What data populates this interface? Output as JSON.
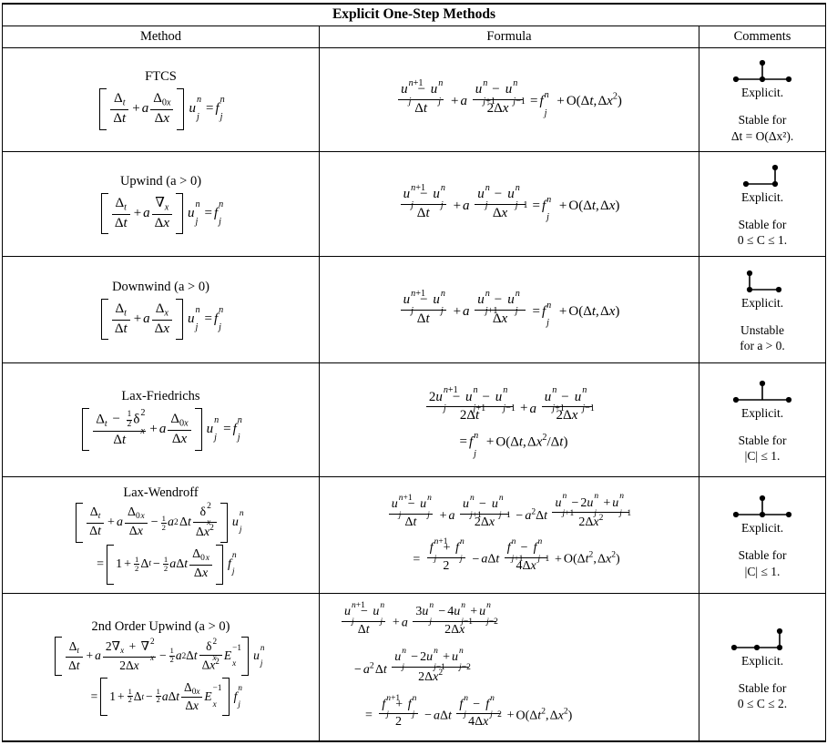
{
  "table": {
    "title": "Explicit One-Step Methods",
    "columns": [
      "Method",
      "Formula",
      "Comments"
    ],
    "rows": [
      {
        "method_name": "FTCS",
        "method_equation": "[ Delta_t/Delta t + a Delta_0x/Delta x ] u_j^n = f_j^n",
        "formula": "(u_j^{n+1} - u_j^n)/Delta t + a (u_{j+1}^n - u_{j-1}^n)/(2 Delta x) = f_j^n + O(Delta t, Delta x^2)",
        "stencil": "T-shape: three nodes at level n (j-1, j, j+1), one node above at level n+1 over j",
        "explicit_label": "Explicit.",
        "stability_line1": "Stable for",
        "stability_line2": "Δt = O(Δx²)."
      },
      {
        "method_name": "Upwind (a > 0)",
        "method_equation": "[ Delta_t/Delta t + a nabla_x/Delta x ] u_j^n = f_j^n",
        "formula": "(u_j^{n+1} - u_j^n)/Delta t + a (u_j^n - u_{j-1}^n)/Delta x = f_j^n + O(Delta t, Delta x)",
        "stencil": "Two nodes at level n (j-1, j), one node above at level n+1 over j",
        "explicit_label": "Explicit.",
        "stability_line1": "Stable for",
        "stability_line2": "0 ≤ C ≤ 1."
      },
      {
        "method_name": "Downwind (a > 0)",
        "method_equation": "[ Delta_t/Delta t + a Delta_x/Delta x ] u_j^n = f_j^n",
        "formula": "(u_j^{n+1} - u_j^n)/Delta t + a (u_{j+1}^n - u_j^n)/Delta x = f_j^n + O(Delta t, Delta x)",
        "stencil": "Two nodes at level n (j, j+1), one node above at level n+1 over j",
        "explicit_label": "Explicit.",
        "stability_line1": "Unstable",
        "stability_line2": "for a > 0."
      },
      {
        "method_name": "Lax-Friedrichs",
        "method_equation": "[ (Delta_t - 1/2 delta_x^2)/Delta t + a Delta_0x/Delta x ] u_j^n = f_j^n",
        "formula": "(2u_j^{n+1} - u_{j+1}^n - u_{j-1}^n)/(2 Delta t) + a (u_{j+1}^n - u_{j-1}^n)/(2 Delta x) = f_j^n + O(Delta t, Delta x^2 / Delta t)",
        "stencil": "Two nodes at level n (j-1, j+1), one node above at level n+1 over j; no center node at level n",
        "explicit_label": "Explicit.",
        "stability_line1": "Stable for",
        "stability_line2": "|C| ≤ 1."
      },
      {
        "method_name": "Lax-Wendroff",
        "method_equation": "[ Delta_t/Delta t + a Delta_0x/Delta x - 1/2 a^2 Delta t delta_x^2/Delta x^2 ] u_j^n = [ 1 + 1/2 Delta_t - 1/2 a Delta t Delta_0x/Delta x ] f_j^n",
        "formula": "(u_j^{n+1} - u_j^n)/Delta t + a (u_{j+1}^n - u_{j-1}^n)/(2 Delta x) - a^2 Delta t (u_{j+1}^n - 2u_j^n + u_{j-1}^n)/(2 Delta x^2) = (f_j^{n+1} + f_j^n)/2 - a Delta t (f_{j+1}^n - f_{j-1}^n)/(4 Delta x) + O(Delta t^2, Delta x^2)",
        "stencil": "Three nodes at level n (j-1, j, j+1), one node above at level n+1 over j",
        "explicit_label": "Explicit.",
        "stability_line1": "Stable for",
        "stability_line2": "|C| ≤ 1."
      },
      {
        "method_name": "2nd Order Upwind (a > 0)",
        "method_equation": "[ Delta_t/Delta t + a (2 nabla_x + nabla_x^2)/(2 Delta x) - 1/2 a^2 Delta t delta_x^2/Delta x^2 E_x^{-1} ] u_j^n = [ 1 + 1/2 Delta_t - 1/2 a Delta t Delta_0x/Delta x E_x^{-1} ] f_j^n",
        "formula": "(u_j^{n+1} - u_j^n)/Delta t + a (3u_j^n - 4u_{j-1}^n + u_{j-2}^n)/(2 Delta x) - a^2 Delta t (u_j^n - 2u_{j-1}^n + u_{j-2}^n)/(2 Delta x^2) = (f_j^{n+1} + f_j^n)/2 - a Delta t (f_j^n - f_{j-2}^n)/(4 Delta x) + O(Delta t^2, Delta x^2)",
        "stencil": "Three nodes at level n (j-2, j-1, j), one node above at level n+1 over j",
        "explicit_label": "Explicit.",
        "stability_line1": "Stable for",
        "stability_line2": "0 ≤ C ≤ 2."
      }
    ]
  },
  "colors": {
    "ink": "#000000",
    "paper": "#ffffff"
  }
}
